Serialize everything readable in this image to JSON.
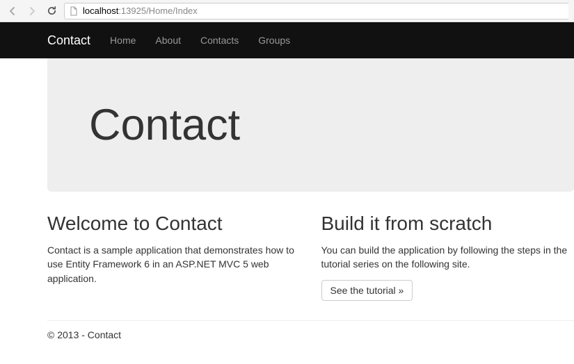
{
  "browser": {
    "url_host": "localhost",
    "url_path": ":13925/Home/Index"
  },
  "navbar": {
    "brand": "Contact",
    "items": [
      "Home",
      "About",
      "Contacts",
      "Groups"
    ]
  },
  "jumbotron": {
    "title": "Contact"
  },
  "columns": {
    "left": {
      "heading": "Welcome to Contact",
      "body": "Contact is a sample application that demonstrates how to use Entity Framework 6 in an ASP.NET MVC 5 web application."
    },
    "right": {
      "heading": "Build it from scratch",
      "body": "You can build the application by following the steps in the tutorial series on the following site.",
      "button": "See the tutorial »"
    }
  },
  "footer": {
    "text": "© 2013 - Contact"
  }
}
